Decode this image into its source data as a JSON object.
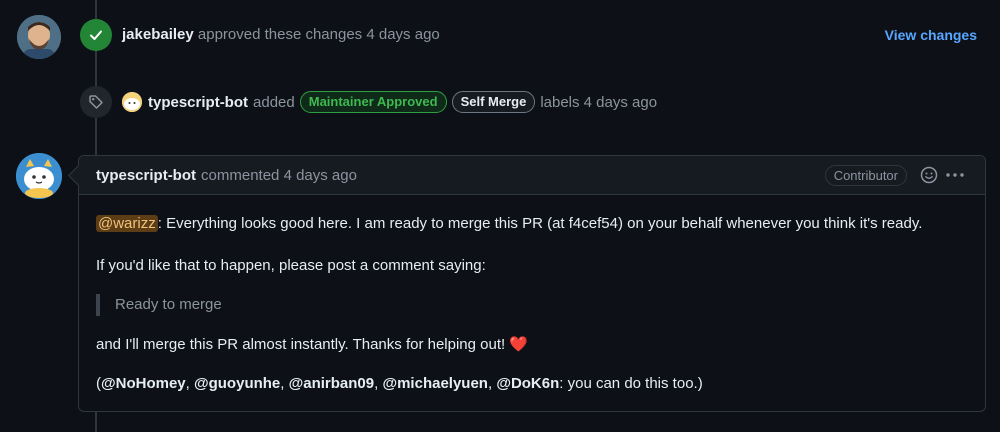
{
  "approval": {
    "user": "jakebailey",
    "action": "approved these changes",
    "time": "4 days ago",
    "view_changes": "View changes"
  },
  "labels_event": {
    "user": "typescript-bot",
    "action": "added",
    "labels": [
      "Maintainer Approved",
      "Self Merge"
    ],
    "tail": "labels 4 days ago"
  },
  "comment": {
    "user": "typescript-bot",
    "action": "commented",
    "time": "4 days ago",
    "role": "Contributor",
    "mention": "@warizz",
    "line1_rest": ": Everything looks good here. I am ready to merge this PR (at f4cef54) on your behalf whenever you think it's ready.",
    "line2": "If you'd like that to happen, please post a comment saying:",
    "quote": "Ready to merge",
    "line3": "and I'll merge this PR almost instantly. Thanks for helping out!",
    "line3_emoji": "❤️",
    "mentions": [
      "@NoHomey",
      "@guoyunhe",
      "@anirban09",
      "@michaelyuen",
      "@DoK6n"
    ],
    "line4_suffix": ": you can do this too.)"
  },
  "colors": {
    "background": "#0d1117",
    "link": "#58a6ff",
    "success": "#238636",
    "label_green": "#3fb950"
  },
  "icons": [
    "check-icon",
    "tag-icon",
    "smiley-icon",
    "kebab-icon",
    "heart-icon"
  ]
}
